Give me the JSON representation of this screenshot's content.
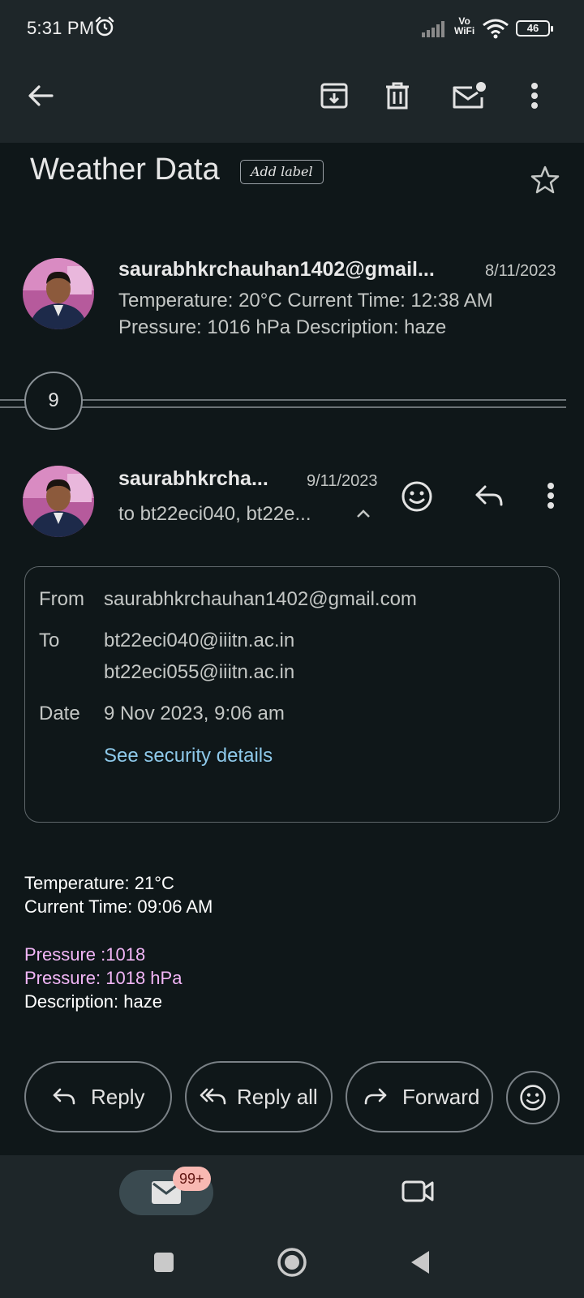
{
  "status_bar": {
    "time": "5:31 PM",
    "vowifi_top": "Vo",
    "vowifi_bottom": "WiFi",
    "battery": "46"
  },
  "toolbar": {
    "icons": [
      "back-arrow-icon",
      "archive-icon",
      "delete-icon",
      "mark-unread-icon",
      "more-vert-icon"
    ]
  },
  "subject": "Weather Data",
  "label_chip": "Add label",
  "first_message": {
    "sender": "saurabhkrchauhan1402@gmail...",
    "date": "8/11/2023",
    "snippet_line1": "Temperature: 20°C Current Time: 12:38 AM",
    "snippet_line2": "Pressure: 1016 hPa Description: haze"
  },
  "collapsed_count": "9",
  "latest_message": {
    "sender": "saurabhkrcha...",
    "date": "9/11/2023",
    "recipients": "to bt22eci040, bt22e..."
  },
  "details": {
    "from_label": "From",
    "from_value": "saurabhkrchauhan1402@gmail.com",
    "to_label": "To",
    "to_value_1": "bt22eci040@iiitn.ac.in",
    "to_value_2": "bt22eci055@iiitn.ac.in",
    "date_label": "Date",
    "date_value": "9 Nov 2023, 9:06 am",
    "security_link": "See security details"
  },
  "body": {
    "line1": "Temperature: 21°C",
    "line2": "Current Time: 09:06 AM",
    "line3": "Pressure :1018",
    "line4": "Pressure: 1018 hPa",
    "line5": "Description: haze"
  },
  "actions": {
    "reply": "Reply",
    "reply_all": "Reply all",
    "forward": "Forward"
  },
  "bottom_nav": {
    "unread_badge": "99+"
  },
  "colors": {
    "background": "#0f1719",
    "bar": "#1e2629",
    "link": "#8ec9ea",
    "pink_text": "#f2b6f7",
    "badge": "#f8b8b2"
  }
}
